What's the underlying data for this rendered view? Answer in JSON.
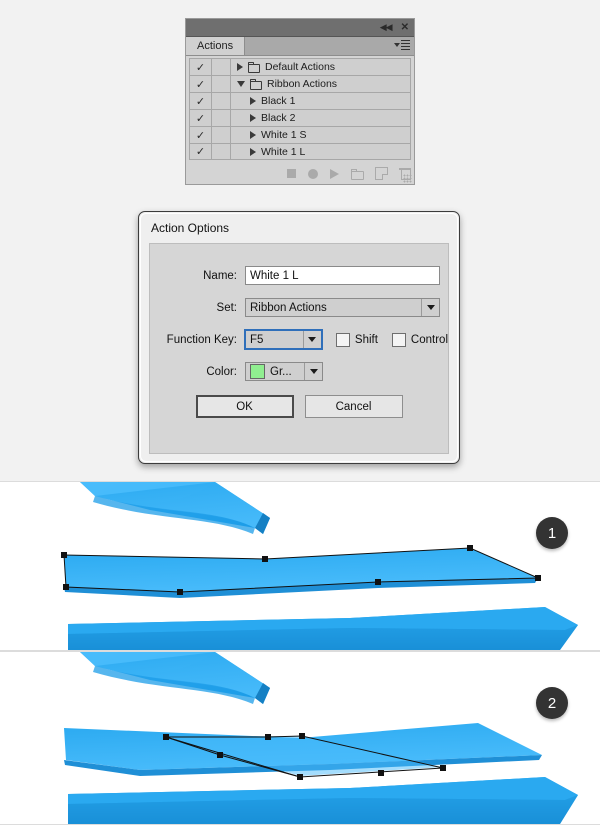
{
  "panel": {
    "title": "Actions",
    "topbar": {
      "collapse_icon": "collapse-icon",
      "close_icon": "close-icon",
      "menu_icon": "panel-menu-icon"
    },
    "rows": [
      {
        "check": "✓",
        "label": "Default Actions",
        "type": "set",
        "expanded": false,
        "indent": false
      },
      {
        "check": "✓",
        "label": "Ribbon Actions",
        "type": "set",
        "expanded": true,
        "indent": false
      },
      {
        "check": "✓",
        "label": "Black 1",
        "type": "action",
        "expanded": false,
        "indent": true
      },
      {
        "check": "✓",
        "label": "Black 2",
        "type": "action",
        "expanded": false,
        "indent": true
      },
      {
        "check": "✓",
        "label": "White 1 S",
        "type": "action",
        "expanded": false,
        "indent": true
      },
      {
        "check": "✓",
        "label": "White 1 L",
        "type": "action",
        "expanded": false,
        "indent": true
      }
    ],
    "footer_icons": [
      "stop-icon",
      "record-icon",
      "play-icon",
      "new-set-icon",
      "new-action-icon",
      "delete-icon"
    ]
  },
  "dialog": {
    "title": "Action Options",
    "name_label": "Name:",
    "name_value": "White 1 L",
    "set_label": "Set:",
    "set_value": "Ribbon Actions",
    "function_key_label": "Function Key:",
    "function_key_value": "F5",
    "shift_label": "Shift",
    "shift_checked": false,
    "control_label": "Control",
    "control_checked": false,
    "color_label": "Color:",
    "color_value": "Gr...",
    "color_swatch": "#90ee90",
    "ok_label": "OK",
    "cancel_label": "Cancel"
  },
  "illustration": {
    "badge_1": "1",
    "badge_2": "2",
    "colors": {
      "ribbon_light": "#38b0f5",
      "ribbon_main": "#2aa9f0",
      "ribbon_mid": "#1e9de8",
      "ribbon_dark": "#1f8fd6",
      "ribbon_darker": "#1580c4",
      "anchor": "#111111",
      "path_stroke": "#111111",
      "panel_bg": "#ffffff"
    }
  }
}
